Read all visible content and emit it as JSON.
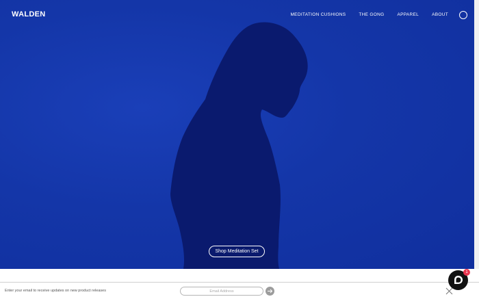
{
  "brand": {
    "logo": "WALDEN"
  },
  "nav": {
    "items": [
      {
        "label": "MEDITATION CUSHIONS"
      },
      {
        "label": "THE GONG"
      },
      {
        "label": "APPAREL"
      },
      {
        "label": "ABOUT"
      }
    ],
    "search_icon": "search-icon"
  },
  "hero": {
    "cta_label": "Shop Meditation Set",
    "background_color": "#1436a8",
    "silhouette_color": "#0a1a6e"
  },
  "signup": {
    "prompt": "Enter your email to receive updates on new product releases",
    "email_placeholder": "Email Address",
    "submit_icon": "arrow-right-icon",
    "close_icon": "close-icon"
  },
  "chat": {
    "icon": "chat-bubble-icon",
    "badge_count": "1",
    "badge_color": "#e8344e"
  }
}
